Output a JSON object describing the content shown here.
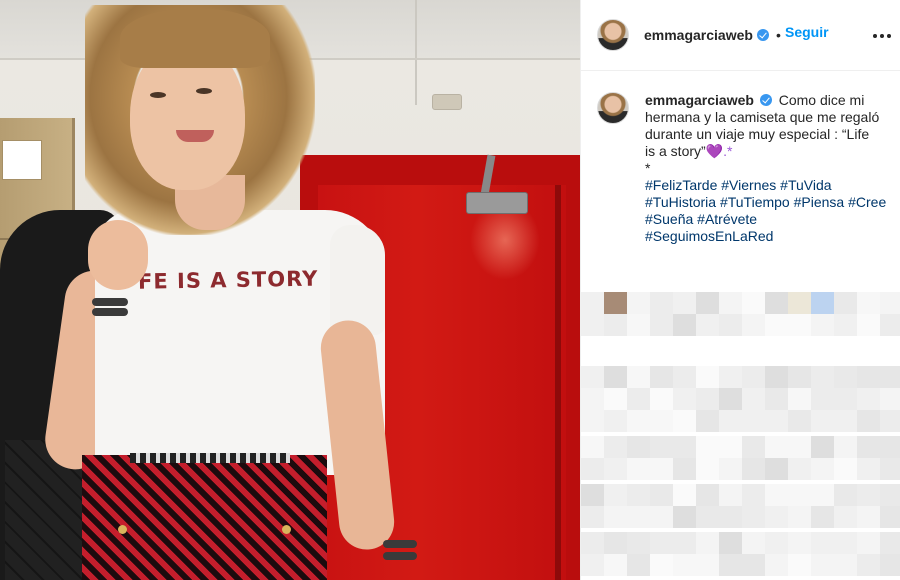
{
  "post": {
    "author": "emmagarciaweb",
    "follow_label": "Seguir",
    "separator": "•",
    "caption_lines": [
      "Como dice mi",
      "hermana y la camiseta que me regaló",
      "durante un viaje muy especial : “Life",
      "is a story”",
      "*"
    ],
    "caption_emoji": "💜.*",
    "hashtags_lines": [
      [
        "#FelizTarde",
        "#Viernes",
        "#TuVida"
      ],
      [
        "#TuHistoria",
        "#TuTiempo",
        "#Piensa",
        "#Cree"
      ],
      [
        "#Sueña",
        "#Atrévete"
      ],
      [
        "#SeguimosEnLaRed"
      ]
    ]
  },
  "photo": {
    "shirt_text": "FE IS A STORY"
  },
  "colors": {
    "accent": "#0095f6",
    "verified": "#3897f0",
    "hashtag": "#00376b",
    "door": "#c81212"
  },
  "icons": {
    "verified": "verified-badge-icon",
    "more": "more-options-icon"
  }
}
